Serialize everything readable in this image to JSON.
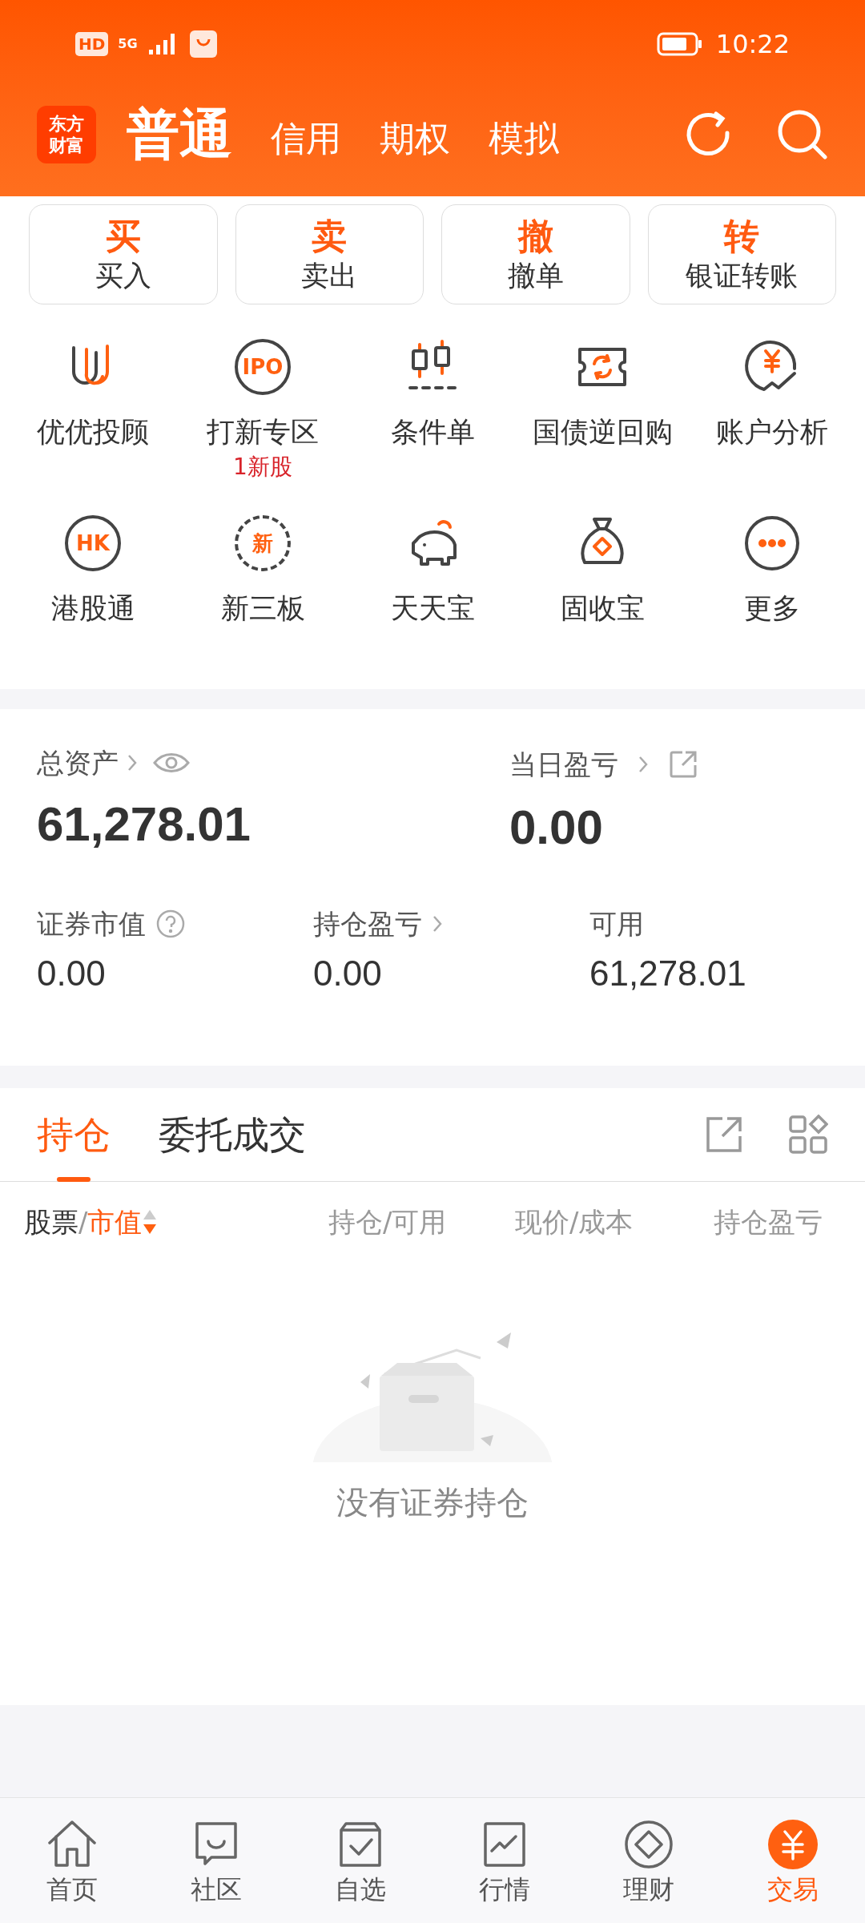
{
  "status_bar": {
    "hd": "HD",
    "network": "5G",
    "time": "10:22"
  },
  "header": {
    "logo_lines": [
      "东方",
      "财富"
    ],
    "tabs": [
      {
        "label": "普通",
        "selected": true
      },
      {
        "label": "信用",
        "selected": false
      },
      {
        "label": "期权",
        "selected": false
      },
      {
        "label": "模拟",
        "selected": false
      }
    ]
  },
  "quick_actions": [
    {
      "glyph": "买",
      "label": "买入"
    },
    {
      "glyph": "卖",
      "label": "卖出"
    },
    {
      "glyph": "撤",
      "label": "撤单"
    },
    {
      "glyph": "转",
      "label": "银证转账"
    }
  ],
  "tools": [
    {
      "kind": "advisor",
      "label": "优优投顾"
    },
    {
      "kind": "ipo",
      "icon_text": "IPO",
      "label": "打新专区",
      "badge": "1新股"
    },
    {
      "kind": "condition",
      "label": "条件单"
    },
    {
      "kind": "repo",
      "label": "国债逆回购"
    },
    {
      "kind": "analysis",
      "label": "账户分析"
    },
    {
      "kind": "hk",
      "icon_text": "HK",
      "label": "港股通"
    },
    {
      "kind": "neeq",
      "icon_text": "新",
      "label": "新三板"
    },
    {
      "kind": "piggy",
      "label": "天天宝"
    },
    {
      "kind": "moneybag",
      "label": "固收宝"
    },
    {
      "kind": "more",
      "label": "更多"
    }
  ],
  "assets": {
    "total": {
      "label": "总资产",
      "value": "61,278.01"
    },
    "daily": {
      "label": "当日盈亏",
      "value": "0.00"
    },
    "stats": [
      {
        "kind": "help",
        "label": "证券市值",
        "value": "0.00"
      },
      {
        "kind": "link",
        "label": "持仓盈亏",
        "value": "0.00"
      },
      {
        "kind": "plain",
        "label": "可用",
        "value": "61,278.01"
      }
    ]
  },
  "positions": {
    "tabs": [
      {
        "label": "持仓",
        "selected": true
      },
      {
        "label": "委托成交",
        "selected": false
      }
    ],
    "columns": [
      {
        "label": "股票",
        "separator": "/",
        "sort_label": "市值",
        "sort_descending": true
      },
      {
        "label": "持仓/可用"
      },
      {
        "label": "现价/成本"
      },
      {
        "label": "持仓盈亏"
      }
    ],
    "empty_message": "没有证券持仓"
  },
  "bottom_nav": [
    {
      "kind": "home",
      "label": "首页",
      "selected": false
    },
    {
      "kind": "community",
      "label": "社区",
      "selected": false
    },
    {
      "kind": "watchlist",
      "label": "自选",
      "selected": false
    },
    {
      "kind": "market",
      "label": "行情",
      "selected": false
    },
    {
      "kind": "wealth",
      "label": "理财",
      "selected": false
    },
    {
      "kind": "trade",
      "label": "交易",
      "selected": true
    }
  ]
}
